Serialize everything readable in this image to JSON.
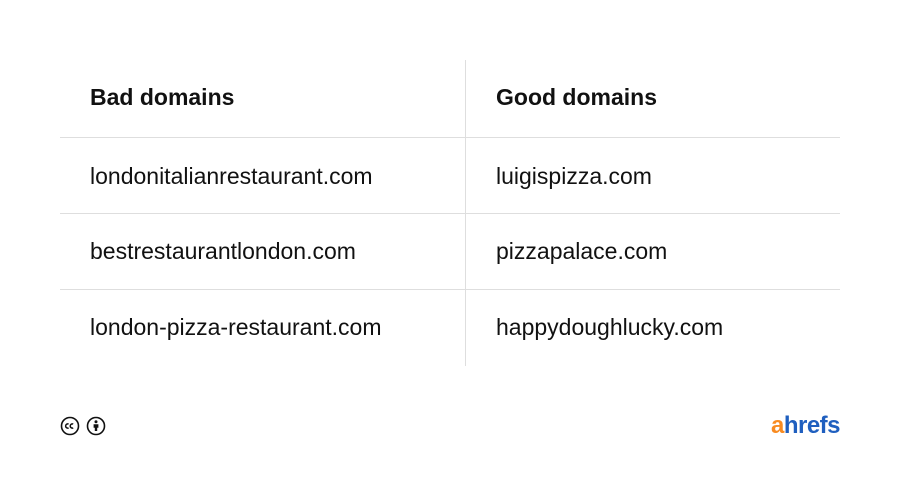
{
  "table": {
    "headers": {
      "left": "Bad domains",
      "right": "Good domains"
    },
    "rows": [
      {
        "bad": "londonitalianrestaurant.com",
        "good": "luigispizza.com"
      },
      {
        "bad": "bestrestaurantlondon.com",
        "good": "pizzapalace.com"
      },
      {
        "bad": "london-pizza-restaurant.com",
        "good": "happydoughlucky.com"
      }
    ]
  },
  "footer": {
    "license_icons": [
      "creative-commons-icon",
      "attribution-icon"
    ],
    "brand": {
      "accent": "a",
      "rest": "hrefs",
      "accent_color": "#f88b21",
      "rest_color": "#1f5fbf"
    }
  },
  "colors": {
    "text": "#111111",
    "divider": "#dedede",
    "background": "#ffffff"
  }
}
